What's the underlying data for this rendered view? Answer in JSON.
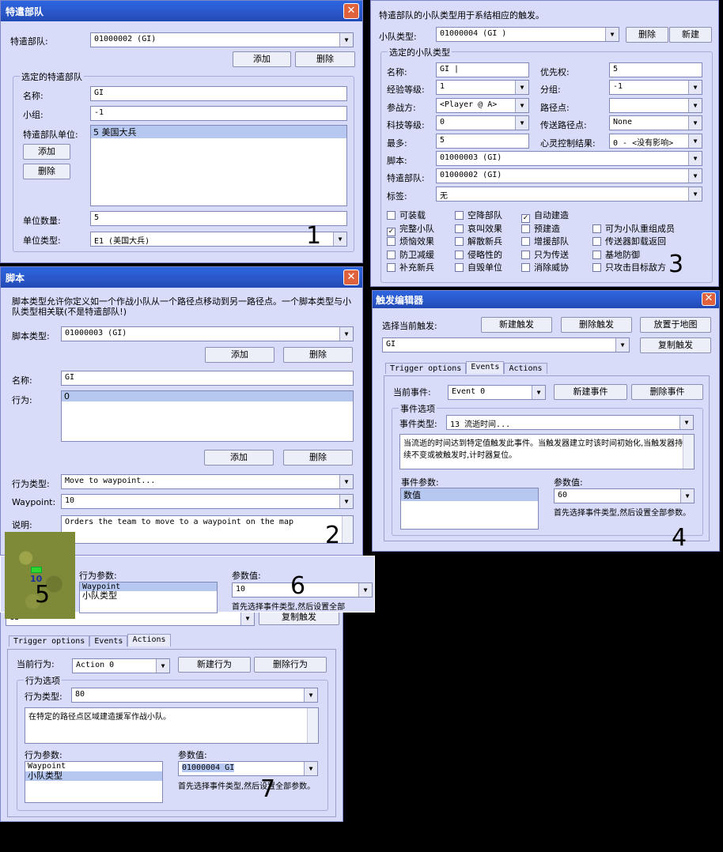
{
  "w1": {
    "title": "特遣部队",
    "team_label": "特遣部队:",
    "team_value": "01000002 (GI)",
    "add": "添加",
    "delete": "删除",
    "group": "选定的特遣部队",
    "name_label": "名称:",
    "name_value": "GI",
    "subgroup_label": "小组:",
    "subgroup_value": "-1",
    "units_label": "特遣部队单位:",
    "units_list": [
      "5 美国大兵"
    ],
    "unit_add": "添加",
    "unit_delete": "删除",
    "count_label": "单位数量:",
    "count_value": "5",
    "type_label": "单位类型:",
    "type_value": "E1 (美国大兵)",
    "marker": "1"
  },
  "w2": {
    "title": "脚本",
    "desc": "脚本类型允许你定义如一个作战小队从一个路径点移动到另一路径点。一个脚本类型与小队类型相关联(不是特遣部队!)",
    "script_label": "脚本类型:",
    "script_value": "01000003 (GI)",
    "add": "添加",
    "delete": "删除",
    "name_label": "名称:",
    "name_value": "GI",
    "action_label": "行为:",
    "action_list": [
      "0"
    ],
    "add2": "添加",
    "delete2": "删除",
    "action_type_label": "行为类型:",
    "action_type_value": "Move to waypoint...",
    "waypoint_label": "Waypoint:",
    "waypoint_value": "10",
    "note_label": "说明:",
    "note_value": "Orders the team to move to a waypoint on the map",
    "marker": "2"
  },
  "w3": {
    "header": "特遣部队的小队类型用于系结相应的触发。",
    "team_type_label": "小队类型:",
    "team_type_value": "01000004 (GI )",
    "delete": "删除",
    "new": "新建",
    "group": "选定的小队类型",
    "name_label": "名称:",
    "name_value": "GI |",
    "priority_label": "优先权:",
    "priority_value": "5",
    "exp_label": "经验等级:",
    "exp_value": "1",
    "group_label": "分组:",
    "group_value": "-1",
    "side_label": "参战方:",
    "side_value": "<Player @ A>",
    "waypoint_label": "路径点:",
    "waypoint_value": "",
    "tech_label": "科技等级:",
    "tech_value": "0",
    "transport_label": "传送路径点:",
    "transport_value": "None",
    "max_label": "最多:",
    "max_value": "5",
    "mind_label": "心灵控制结果:",
    "mind_value": "0 - <没有影响>",
    "script_label": "脚本:",
    "script_value": "01000003 (GI)",
    "task_label": "特遣部队:",
    "task_value": "01000002 (GI)",
    "tag_label": "标签:",
    "tag_value": "无",
    "checks": [
      {
        "label": "可装载",
        "checked": false
      },
      {
        "label": "空降部队",
        "checked": false
      },
      {
        "label": "自动建造",
        "checked": true
      },
      {
        "label": "完整小队",
        "checked": true
      },
      {
        "label": "哀叫效果",
        "checked": false
      },
      {
        "label": "预建造",
        "checked": false
      },
      {
        "label": "可为小队重组成员",
        "checked": false
      },
      {
        "label": "烦恼效果",
        "checked": false
      },
      {
        "label": "解散新兵",
        "checked": false
      },
      {
        "label": "增援部队",
        "checked": false
      },
      {
        "label": "传送器卸载返回",
        "checked": false
      },
      {
        "label": "防卫减缓",
        "checked": false
      },
      {
        "label": "侵略性的",
        "checked": false
      },
      {
        "label": "只为传送",
        "checked": false
      },
      {
        "label": "基地防御",
        "checked": false
      },
      {
        "label": "补充新兵",
        "checked": false
      },
      {
        "label": "自毁单位",
        "checked": false
      },
      {
        "label": "消除威协",
        "checked": false
      },
      {
        "label": "只攻击目标敌方",
        "checked": false
      }
    ],
    "marker": "3"
  },
  "w4": {
    "title": "触发编辑器",
    "select_label": "选择当前触发:",
    "new_trigger": "新建触发",
    "delete_trigger": "删除触发",
    "place_on_map": "放置于地图",
    "trigger_value": "GI",
    "copy_trigger": "复制触发",
    "tabs": [
      "Trigger options",
      "Events",
      "Actions"
    ],
    "current_event_label": "当前事件:",
    "current_event_value": "Event 0",
    "new_event": "新建事件",
    "delete_event": "删除事件",
    "group": "事件选项",
    "event_type_label": "事件类型:",
    "event_type_value": "13 流逝时间...",
    "event_desc": "当流逝的时间达到特定值触发此事件。当触发器建立时该时间初始化,当触发器持续不变或被触发时,计时器复位。",
    "param_label": "事件参数:",
    "param_list": [
      "数值"
    ],
    "value_label": "参数值:",
    "value_value": "60",
    "hint": "首先选择事件类型,然后设置全部参数。",
    "marker": "4"
  },
  "w6": {
    "param_label": "行为参数:",
    "param_list": [
      "Waypoint",
      "小队类型"
    ],
    "value_label": "参数值:",
    "value_value": "10",
    "hint": "首先选择事件类型,然后设置全部",
    "trigger_value": "GI",
    "copy_trigger": "复制触发",
    "marker5": "5",
    "marker6": "6"
  },
  "w7": {
    "tabs": [
      "Trigger options",
      "Events",
      "Actions"
    ],
    "current_action_label": "当前行为:",
    "current_action_value": "Action 0",
    "new_action": "新建行为",
    "delete_action": "删除行为",
    "group": "行为选项",
    "action_type_label": "行为类型:",
    "action_type_value": "80",
    "action_desc": "在特定的路径点区域建造援军作战小队。",
    "param_label": "行为参数:",
    "param_list": [
      "Waypoint",
      "小队类型"
    ],
    "value_label": "参数值:",
    "value_value": "01000004 GI",
    "hint": "首先选择事件类型,然后设置全部参数。",
    "marker": "7"
  }
}
